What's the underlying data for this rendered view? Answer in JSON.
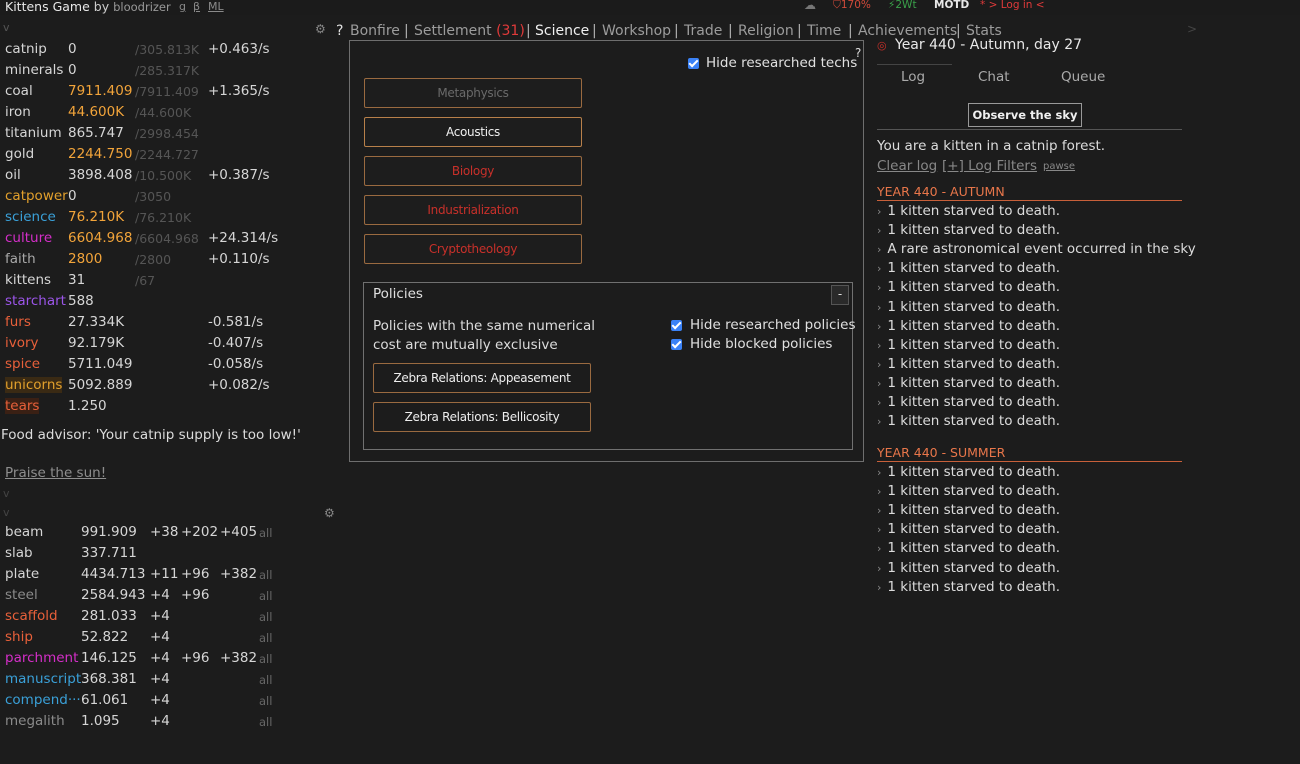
{
  "header": {
    "app_title": "Kittens Game",
    "by": "by",
    "author": "bloodrizer",
    "links": [
      "g",
      "β",
      "ML"
    ],
    "zoom": "170%",
    "energy": "2Wt",
    "motd": "MOTD",
    "login": "* > Log in <"
  },
  "resources": [
    {
      "name": "catnip",
      "value": "0",
      "max": "/305.813K",
      "rate": "+0.463/s",
      "color": "#d6d6d6",
      "valcolor": "#d6d6d6"
    },
    {
      "name": "minerals",
      "value": "0",
      "max": "/285.317K",
      "rate": "",
      "color": "#d6d6d6",
      "valcolor": "#d6d6d6"
    },
    {
      "name": "coal",
      "value": "7911.409",
      "max": "/7911.409",
      "rate": "+1.365/s",
      "color": "#d6d6d6",
      "valcolor": "#f2a43a"
    },
    {
      "name": "iron",
      "value": "44.600K",
      "max": "/44.600K",
      "rate": "",
      "color": "#d6d6d6",
      "valcolor": "#f2a43a"
    },
    {
      "name": "titanium",
      "value": "865.747",
      "max": "/2998.454",
      "rate": "",
      "color": "#d6d6d6",
      "valcolor": "#d6d6d6"
    },
    {
      "name": "gold",
      "value": "2244.750",
      "max": "/2244.727",
      "rate": "",
      "color": "#d6d6d6",
      "valcolor": "#f2a43a"
    },
    {
      "name": "oil",
      "value": "3898.408",
      "max": "/10.500K",
      "rate": "+0.387/s",
      "color": "#d6d6d6",
      "valcolor": "#d6d6d6"
    },
    {
      "name": "catpower",
      "value": "0",
      "max": "/3050",
      "rate": "",
      "color": "#e2a02c",
      "valcolor": "#d6d6d6"
    },
    {
      "name": "science",
      "value": "76.210K",
      "max": "/76.210K",
      "rate": "",
      "color": "#3aa0d8",
      "valcolor": "#f2a43a"
    },
    {
      "name": "culture",
      "value": "6604.968",
      "max": "/6604.968",
      "rate": "+24.314/s",
      "color": "#d42ec8",
      "valcolor": "#f2a43a"
    },
    {
      "name": "faith",
      "value": "2800",
      "max": "/2800",
      "rate": "+0.110/s",
      "color": "#a8a8a8",
      "valcolor": "#f2a43a"
    },
    {
      "name": "kittens",
      "value": "31",
      "max": "/67",
      "rate": "",
      "color": "#d6d6d6",
      "valcolor": "#d6d6d6"
    },
    {
      "name": "starchart",
      "value": "588",
      "max": "",
      "rate": "",
      "color": "#9b55e8",
      "valcolor": "#d6d6d6"
    },
    {
      "name": "furs",
      "value": "27.334K",
      "max": "",
      "rate": "-0.581/s",
      "color": "#e8603a",
      "valcolor": "#d6d6d6"
    },
    {
      "name": "ivory",
      "value": "92.179K",
      "max": "",
      "rate": "-0.407/s",
      "color": "#e8603a",
      "valcolor": "#d6d6d6"
    },
    {
      "name": "spice",
      "value": "5711.049",
      "max": "",
      "rate": "-0.058/s",
      "color": "#e8603a",
      "valcolor": "#d6d6d6"
    },
    {
      "name": "unicorns",
      "value": "5092.889",
      "max": "",
      "rate": "+0.082/s",
      "color": "#e2a02c",
      "valcolor": "#d6d6d6"
    },
    {
      "name": "tears",
      "value": "1.250",
      "max": "",
      "rate": "",
      "color": "#e8603a",
      "valcolor": "#d6d6d6"
    }
  ],
  "advisor": "Food advisor: 'Your catnip supply is too low!'",
  "praise": "Praise the sun!",
  "crafts": [
    {
      "name": "beam",
      "value": "991.909",
      "p1": "+38",
      "p2": "+202",
      "p3": "+405",
      "all": "all",
      "color": "#d6d6d6"
    },
    {
      "name": "slab",
      "value": "337.711",
      "p1": "",
      "p2": "",
      "p3": "",
      "all": "",
      "color": "#d6d6d6"
    },
    {
      "name": "plate",
      "value": "4434.713",
      "p1": "+11",
      "p2": "+96",
      "p3": "+382",
      "all": "all",
      "color": "#d6d6d6"
    },
    {
      "name": "steel",
      "value": "2584.943",
      "p1": "+4",
      "p2": "+96",
      "p3": "",
      "all": "all",
      "color": "#8a8a8a"
    },
    {
      "name": "scaffold",
      "value": "281.033",
      "p1": "+4",
      "p2": "",
      "p3": "",
      "all": "all",
      "color": "#e8603a"
    },
    {
      "name": "ship",
      "value": "52.822",
      "p1": "+4",
      "p2": "",
      "p3": "",
      "all": "all",
      "color": "#e8603a"
    },
    {
      "name": "parchment",
      "value": "146.125",
      "p1": "+4",
      "p2": "+96",
      "p3": "+382",
      "all": "all",
      "color": "#d42ec8"
    },
    {
      "name": "manuscript",
      "value": "368.381",
      "p1": "+4",
      "p2": "",
      "p3": "",
      "all": "all",
      "color": "#3aa0d8"
    },
    {
      "name": "compend···",
      "value": "61.061",
      "p1": "+4",
      "p2": "",
      "p3": "",
      "all": "all",
      "color": "#3aa0d8"
    },
    {
      "name": "megalith",
      "value": "1.095",
      "p1": "+4",
      "p2": "",
      "p3": "",
      "all": "all",
      "color": "#8a8a8a"
    }
  ],
  "tabs": {
    "help": "?",
    "bonfire": "Bonfire",
    "settlement": "Settlement",
    "settlement_count": "(31)",
    "science": "Science",
    "workshop": "Workshop",
    "trade": "Trade",
    "religion": "Religion",
    "time": "Time",
    "achievements": "Achievements",
    "stats": "Stats"
  },
  "science": {
    "help": "?",
    "hide_researched_techs": "Hide researched techs",
    "techs": [
      {
        "label": "Metaphysics",
        "color": "#6a6a6a"
      },
      {
        "label": "Acoustics",
        "color": "#f0f0f0"
      },
      {
        "label": "Biology",
        "color": "#c8302a"
      },
      {
        "label": "Industrialization",
        "color": "#c8302a"
      },
      {
        "label": "Cryptotheology",
        "color": "#c8302a"
      }
    ],
    "policies_title": "Policies",
    "policies_collapse": "-",
    "policies_note_1": "Policies with the same numerical",
    "policies_note_2": "cost are mutually exclusive",
    "hide_researched_policies": "Hide researched policies",
    "hide_blocked_policies": "Hide blocked policies",
    "policies": [
      "Zebra Relations: Appeasement",
      "Zebra Relations: Bellicosity"
    ]
  },
  "log": {
    "date": "Year 440 - Autumn, day 27",
    "tabs": [
      "Log",
      "Chat",
      "Queue"
    ],
    "observe": "Observe the sky",
    "intro": "You are a kitten in a catnip forest.",
    "clear": "Clear log",
    "filters": "[+] Log Filters",
    "pause": "pawse",
    "autumn_head": "YEAR 440 - AUTUMN",
    "autumn_entries": [
      "1 kitten starved to death.",
      "1 kitten starved to death.",
      "A rare astronomical event occurred in the sky",
      "1 kitten starved to death.",
      "1 kitten starved to death.",
      "1 kitten starved to death.",
      "1 kitten starved to death.",
      "1 kitten starved to death.",
      "1 kitten starved to death.",
      "1 kitten starved to death.",
      "1 kitten starved to death.",
      "1 kitten starved to death."
    ],
    "summer_head": "YEAR 440 - SUMMER",
    "summer_entries": [
      "1 kitten starved to death.",
      "1 kitten starved to death.",
      "1 kitten starved to death.",
      "1 kitten starved to death.",
      "1 kitten starved to death.",
      "1 kitten starved to death.",
      "1 kitten starved to death."
    ]
  }
}
